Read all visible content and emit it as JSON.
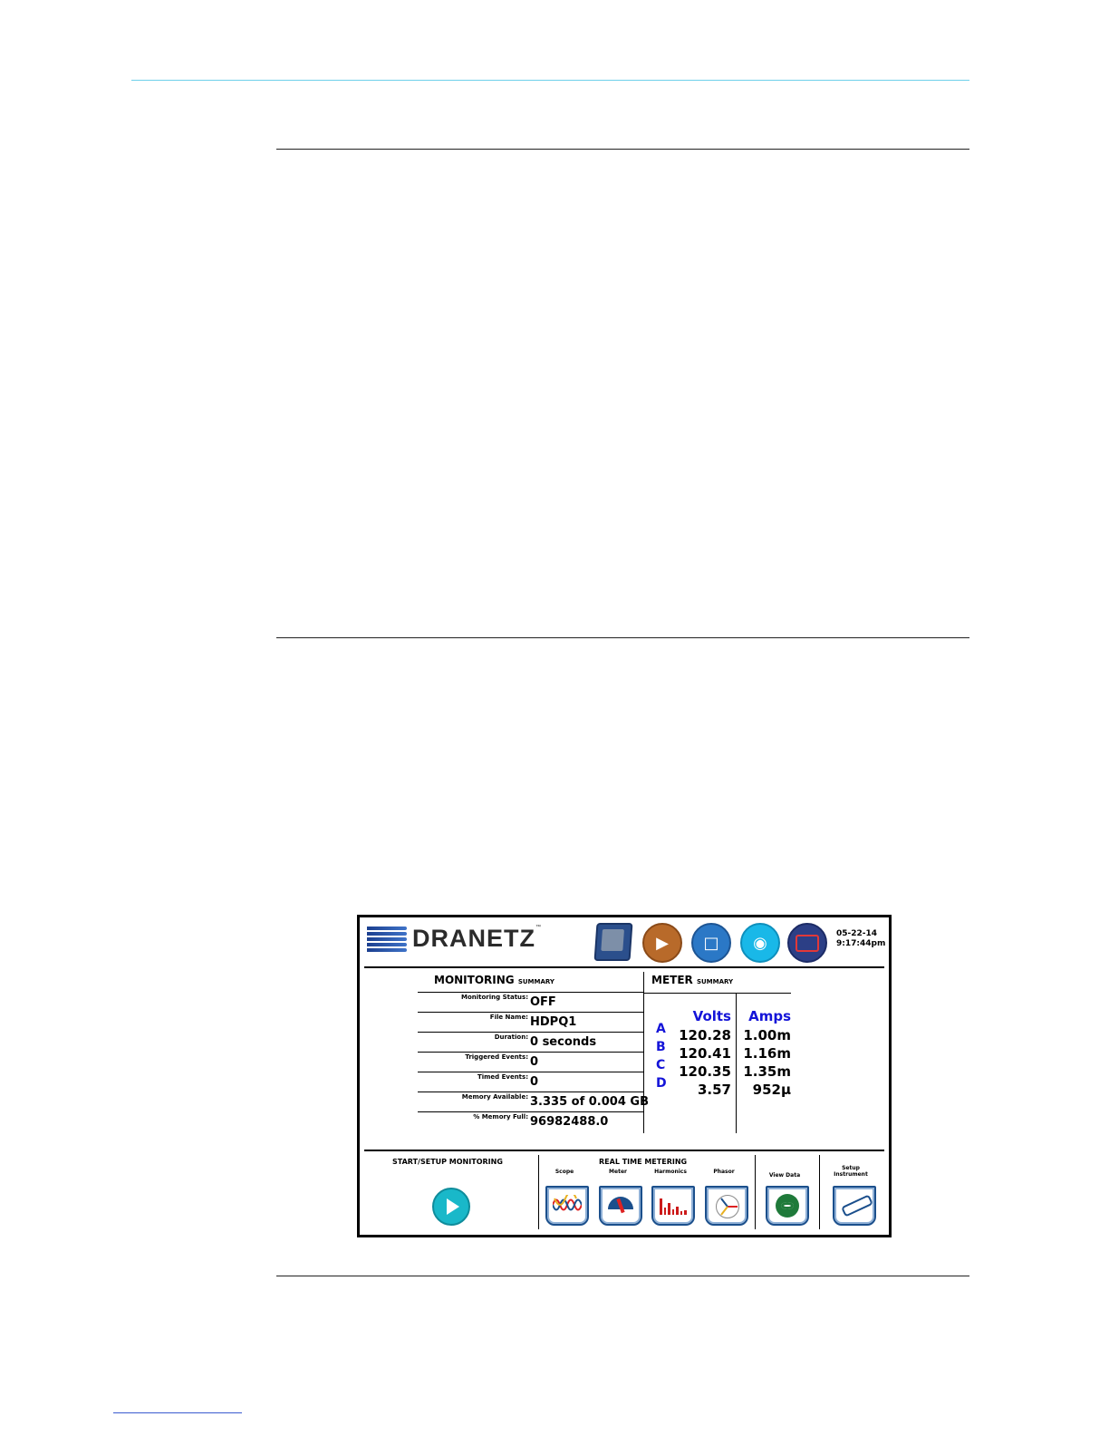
{
  "header": {
    "brand": "DRANETZ",
    "trademark": "™",
    "date": "05-22-14",
    "time": "9:17:44pm",
    "icons": [
      "monitor-screen-icon",
      "camera-icon",
      "document-icon",
      "wireless-icon",
      "display-rect-icon"
    ]
  },
  "monitoring": {
    "title": "MONITORING",
    "title_suffix": "SUMMARY",
    "rows": [
      {
        "label": "Monitoring Status:",
        "value": "OFF"
      },
      {
        "label": "File Name:",
        "value": "HDPQ1"
      },
      {
        "label": "Duration:",
        "value": "0 seconds"
      },
      {
        "label": "Triggered Events:",
        "value": "0"
      },
      {
        "label": "Timed Events:",
        "value": "0"
      },
      {
        "label": "Memory Available:",
        "value": "3.335 of 0.004 GB"
      },
      {
        "label": "% Memory Full:",
        "value": "96982488.0"
      }
    ]
  },
  "meter": {
    "title": "METER",
    "title_suffix": "SUMMARY",
    "volts_header": "Volts",
    "amps_header": "Amps",
    "phases": [
      "A",
      "B",
      "C",
      "D"
    ],
    "volts": [
      "120.28",
      "120.41",
      "120.35",
      "3.57"
    ],
    "amps": [
      "1.00m",
      "1.16m",
      "1.35m",
      "952µ"
    ]
  },
  "bottom": {
    "start_label": "START/SETUP MONITORING",
    "rtm_label": "REAL TIME METERING",
    "tools": [
      "Scope",
      "Meter",
      "Harmonics",
      "Phasor"
    ],
    "view_data": "View Data",
    "setup_line1": "Setup",
    "setup_line2": "Instrument"
  },
  "colors": {
    "accent_blue": "#1414d8",
    "play_teal": "#19b8c9",
    "top_rule": "#6fd0ea"
  }
}
